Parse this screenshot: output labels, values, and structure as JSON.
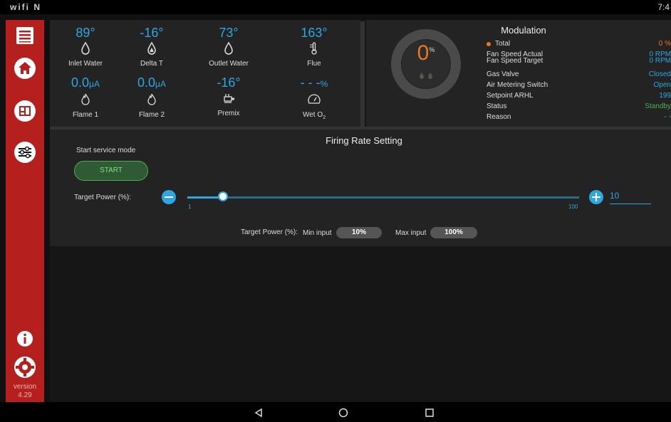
{
  "status_bar": {
    "left_icons": "wifi N",
    "time": "7:4"
  },
  "sidebar": {
    "items": [
      "menu",
      "home",
      "dashboard",
      "settings"
    ],
    "version_label": "version",
    "version_number": "4.29",
    "accent": "#b5201e"
  },
  "sensors": [
    {
      "value": "89°",
      "label": "Inlet Water",
      "icon": "water-drop-icon"
    },
    {
      "value": "-16°",
      "label": "Delta T",
      "icon": "delta-drop-icon"
    },
    {
      "value": "73°",
      "label": "Outlet Water",
      "icon": "water-drop-icon"
    },
    {
      "value": "163°",
      "label": "Flue",
      "icon": "thermometer-icon"
    },
    {
      "value": "0.0",
      "unit": "μA",
      "label": "Flame 1",
      "icon": "flame-icon"
    },
    {
      "value": "0.0",
      "unit": "μA",
      "label": "Flame 2",
      "icon": "flame-icon"
    },
    {
      "value": "-16°",
      "label": "Premix",
      "icon": "premix-icon"
    },
    {
      "value": "- - -",
      "unit": "%",
      "label": "Wet O",
      "label_sub": "2",
      "icon": "gauge-icon"
    }
  ],
  "modulation": {
    "title": "Modulation",
    "gauge_value": "0",
    "gauge_unit": "%",
    "rows": [
      {
        "label": "Total",
        "value": "0 %",
        "color": "#e8771e",
        "dot": true
      },
      {
        "label": "Fan Speed Actual",
        "value": "0 RPM",
        "color": "#2ea7e0"
      },
      {
        "label": "Fan Speed Target",
        "value": "0 RPM",
        "color": "#2ea7e0"
      },
      {
        "label": "Gas Valve",
        "value": "Closed",
        "color": "#2ea7e0"
      },
      {
        "label": "Air Metering Switch",
        "value": "Open",
        "color": "#2ea7e0"
      },
      {
        "label": "Setpoint ARHL",
        "value": "199",
        "color": "#2ea7e0"
      },
      {
        "label": "Status",
        "value": "Standby",
        "color": "#4caf50"
      },
      {
        "label": "Reason",
        "value": "- -",
        "color": "#2ea7e0"
      }
    ]
  },
  "firing": {
    "title": "Firing Rate Setting",
    "service_label": "Start service mode",
    "start_button": "START",
    "target_label": "Target Power (%):",
    "slider_min": "1",
    "slider_max": "100",
    "slider_value": 10,
    "input_value": "10",
    "bottom_label": "Target Power (%):",
    "min_label": "Min input",
    "min_value": "10%",
    "max_label": "Max input",
    "max_value": "100%"
  },
  "navbar": {
    "items": [
      "back",
      "home",
      "recents"
    ]
  }
}
